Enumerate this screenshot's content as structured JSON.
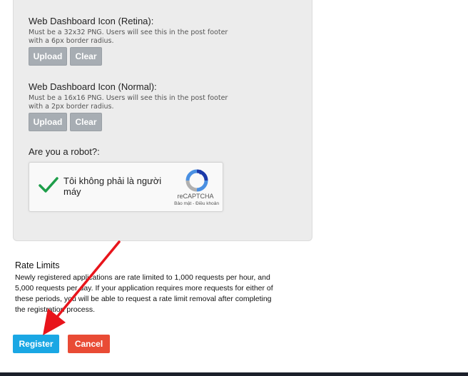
{
  "fields": [
    {
      "label": "Web Dashboard Icon (Retina):",
      "help": "Must be a 32x32 PNG. Users will see this in the post footer with a 6px border radius.",
      "upload": "Upload",
      "clear": "Clear"
    },
    {
      "label": "Web Dashboard Icon (Normal):",
      "help": "Must be a 16x16 PNG. Users will see this in the post footer with a 2px border radius.",
      "upload": "Upload",
      "clear": "Clear"
    }
  ],
  "robot": {
    "label": "Are you a robot?:",
    "checkbox_text": "Tôi không phải là người máy",
    "brand": "reCAPTCHA",
    "terms": "Bảo mật - Điều khoản"
  },
  "rate_limits": {
    "title": "Rate Limits",
    "body": "Newly registered applications are rate limited to 1,000 requests per hour, and 5,000 requests per day. If your application requires more requests for either of these periods, you will be able to request a rate limit removal after completing the registration process."
  },
  "actions": {
    "register": "Register",
    "cancel": "Cancel"
  },
  "colors": {
    "register": "#1aa7e4",
    "cancel": "#e94b35",
    "annotation_arrow": "#e8141b",
    "checkmark": "#1e9e4a"
  }
}
